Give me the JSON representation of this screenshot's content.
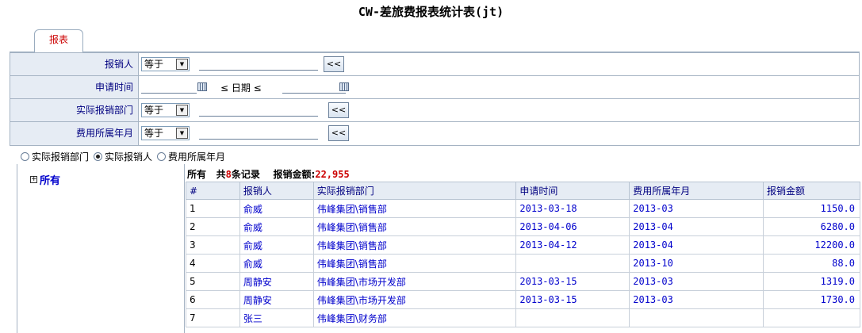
{
  "page_title": "CW-差旅费报表统计表(jt)",
  "tabs": [
    {
      "label": "报表"
    }
  ],
  "filters": {
    "reporter": {
      "label": "报销人",
      "operator": "等于",
      "value": "",
      "button": "<<"
    },
    "apply_time": {
      "label": "申请时间",
      "from": "",
      "middle": "≤ 日期 ≤",
      "to": ""
    },
    "department": {
      "label": "实际报销部门",
      "operator": "等于",
      "value": "",
      "button": "<<"
    },
    "month": {
      "label": "费用所属年月",
      "operator": "等于",
      "value": "",
      "button": "<<"
    }
  },
  "group_by": {
    "options": [
      "实际报销部门",
      "实际报销人",
      "费用所属年月"
    ],
    "selected": "实际报销人"
  },
  "tree": {
    "root": "所有",
    "expand_symbol": "+"
  },
  "summary": {
    "scope": "所有",
    "count_prefix": "共",
    "count": "8",
    "count_suffix": "条记录",
    "amount_label": "报销金额:",
    "amount": "22,955"
  },
  "table": {
    "columns": [
      "#",
      "报销人",
      "实际报销部门",
      "申请时间",
      "费用所属年月",
      "报销金额"
    ],
    "rows": [
      [
        "1",
        "俞威",
        "伟峰集团\\销售部",
        "2013-03-18",
        "2013-03",
        "1150.0"
      ],
      [
        "2",
        "俞威",
        "伟峰集团\\销售部",
        "2013-04-06",
        "2013-04",
        "6280.0"
      ],
      [
        "3",
        "俞威",
        "伟峰集团\\销售部",
        "2013-04-12",
        "2013-04",
        "12200.0"
      ],
      [
        "4",
        "俞威",
        "伟峰集团\\销售部",
        "",
        "2013-10",
        "88.0"
      ],
      [
        "5",
        "周静安",
        "伟峰集团\\市场开发部",
        "2013-03-15",
        "2013-03",
        "1319.0"
      ],
      [
        "6",
        "周静安",
        "伟峰集团\\市场开发部",
        "2013-03-15",
        "2013-03",
        "1730.0"
      ],
      [
        "7",
        "张三",
        "伟峰集团\\财务部",
        "",
        "",
        ""
      ]
    ]
  },
  "colors": {
    "accent_red": "#cc0000",
    "link_blue": "#0000cc",
    "header_bg": "#e6ecf4",
    "border": "#a5b3c3"
  }
}
